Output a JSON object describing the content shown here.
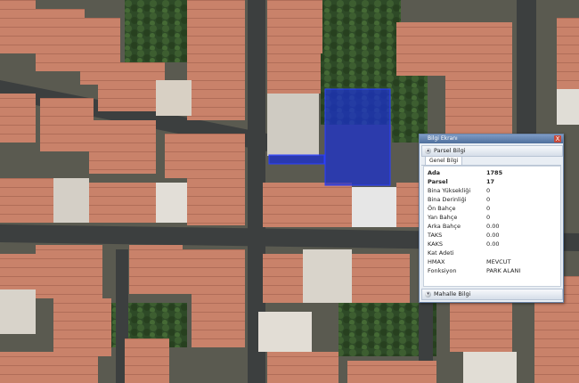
{
  "window": {
    "title": "Bilgi Ekranı",
    "close_glyph": "X"
  },
  "sections": {
    "parsel": "Parsel Bilgi",
    "mahalle": "Mahalle Bilgi"
  },
  "tabs": {
    "genel": "Genel Bilgi"
  },
  "attributes": [
    {
      "key": "Ada",
      "value": "1785"
    },
    {
      "key": "Parsel",
      "value": "17"
    },
    {
      "key": "Bina Yüksekliği",
      "value": "0"
    },
    {
      "key": "Bina Derinliği",
      "value": "0"
    },
    {
      "key": "Ön Bahçe",
      "value": "0"
    },
    {
      "key": "Yan Bahçe",
      "value": "0"
    },
    {
      "key": "Arka Bahçe",
      "value": "0.00"
    },
    {
      "key": "TAKS",
      "value": "0.00"
    },
    {
      "key": "KAKS",
      "value": "0.00"
    },
    {
      "key": "Kat Adeti",
      "value": ""
    },
    {
      "key": "HMAX",
      "value": "MEVCUT"
    },
    {
      "key": "Fonksiyon",
      "value": "PARK ALANI"
    }
  ],
  "colors": {
    "selection_fill": "#1a2fd0",
    "road": "#3c3f3f",
    "roof": "#c9826a",
    "tree": "#2f4f26",
    "titlebar": "#5d7fb0"
  },
  "icons": {
    "section_toggle": "circle-chevron-icon"
  }
}
